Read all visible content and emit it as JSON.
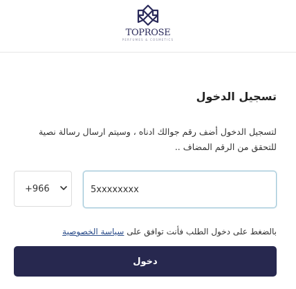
{
  "brand": {
    "name": "TOPROSE",
    "tagline": "PERFUMES & COSMETICS",
    "color": "#2a2a5a"
  },
  "login": {
    "title": "تسجيل الدخول",
    "instructions": "لتسجيل الدخول أضف رقم جوالك ادناه ، وسيتم ارسال رسالة نصية للتحقق من الرقم المضاف ..",
    "country_code": "+966",
    "phone_value": "5xxxxxxxx",
    "terms_text": "بالضغط على دخول الطلب فأنت توافق على",
    "privacy_link": "سياسة الخصوصية",
    "submit_label": "دخول"
  },
  "colors": {
    "button_bg": "#27284f",
    "input_focus_border": "#9fc7d8",
    "link": "#2a4c8a"
  },
  "icons": {
    "logo": "toprose-flower-logo",
    "select_arrow": "chevron-down-icon"
  }
}
